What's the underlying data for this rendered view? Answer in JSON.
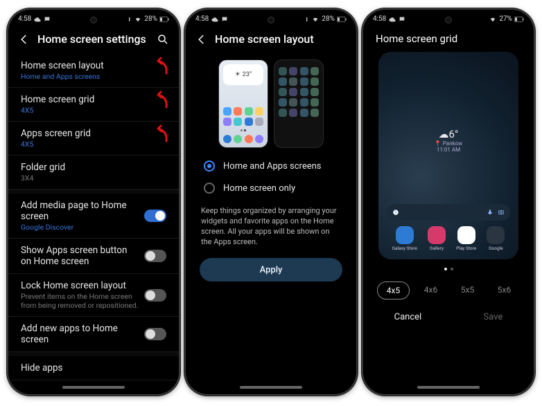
{
  "statusbar": {
    "time": "4:58",
    "battery": "28%",
    "battery3": "27%"
  },
  "screen1": {
    "title": "Home screen settings",
    "items": [
      {
        "label": "Home screen layout",
        "sub": "Home and Apps screens"
      },
      {
        "label": "Home screen grid",
        "sub": "4X5"
      },
      {
        "label": "Apps screen grid",
        "sub": "4X5"
      },
      {
        "label": "Folder grid",
        "sub": "3X4"
      }
    ],
    "toggles": [
      {
        "label": "Add media page to Home screen",
        "sub": "Google Discover",
        "on": true
      },
      {
        "label": "Show Apps screen button on Home screen",
        "on": false
      },
      {
        "label": "Lock Home screen layout",
        "sub": "Prevent items on the Home screen from being removed or repositioned.",
        "on": false
      },
      {
        "label": "Add new apps to Home screen",
        "on": false
      }
    ],
    "hide": "Hide apps"
  },
  "screen2": {
    "title": "Home screen layout",
    "previewTemp": "23°",
    "options": [
      {
        "label": "Home and Apps screens",
        "on": true
      },
      {
        "label": "Home screen only",
        "on": false
      }
    ],
    "desc": "Keep things organized by arranging your widgets and favorite apps on the Home screen. All your apps will be shown on the Apps screen.",
    "apply": "Apply"
  },
  "screen3": {
    "title": "Home screen grid",
    "weather": {
      "temp": "6°",
      "loc": "Pankow",
      "time": "11:01 AM"
    },
    "dock": [
      {
        "label": "Galaxy Store",
        "color": "#2e7bd6"
      },
      {
        "label": "Gallery",
        "color": "#d63a6a"
      },
      {
        "label": "Play Store",
        "color": "#ffffff"
      },
      {
        "label": "Google",
        "color": "#2b3441"
      }
    ],
    "grids": [
      "4x5",
      "4x6",
      "5x5",
      "5x6"
    ],
    "selected": "4x5",
    "cancel": "Cancel",
    "save": "Save"
  }
}
